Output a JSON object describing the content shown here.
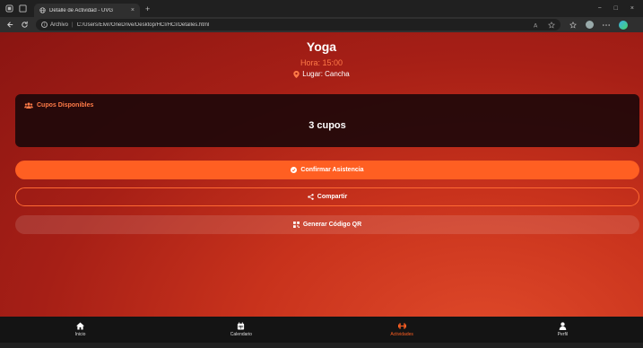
{
  "browser": {
    "tab_title": "Detalle de Actividad - UVG",
    "tab_close": "×",
    "new_tab": "+",
    "window_controls": [
      "−",
      "□",
      "×"
    ],
    "address_label": "Archivo",
    "url": "C:/Users/Elvir/OneDrive/Desktop/HCI/HCI/Detalles.html"
  },
  "activity": {
    "title": "Yoga",
    "time": "Hora: 15:00",
    "place": "Lugar: Cancha"
  },
  "slots_card": {
    "heading": "Cupos Disponibles",
    "value": "3 cupos"
  },
  "actions": {
    "confirm": "Confirmar Asistencia",
    "share": "Compartir",
    "qr": "Generar Código QR"
  },
  "bottom_nav": {
    "items": [
      {
        "label": "Inicio",
        "icon": "home-icon"
      },
      {
        "label": "Calendario",
        "icon": "calendar-icon"
      },
      {
        "label": "Actividades",
        "icon": "dumbbell-icon",
        "active": true
      },
      {
        "label": "Perfil",
        "icon": "user-icon"
      }
    ]
  },
  "colors": {
    "accent": "#ff5f22",
    "card_bg": "#1e080a",
    "page_bg": "#a61f16"
  }
}
